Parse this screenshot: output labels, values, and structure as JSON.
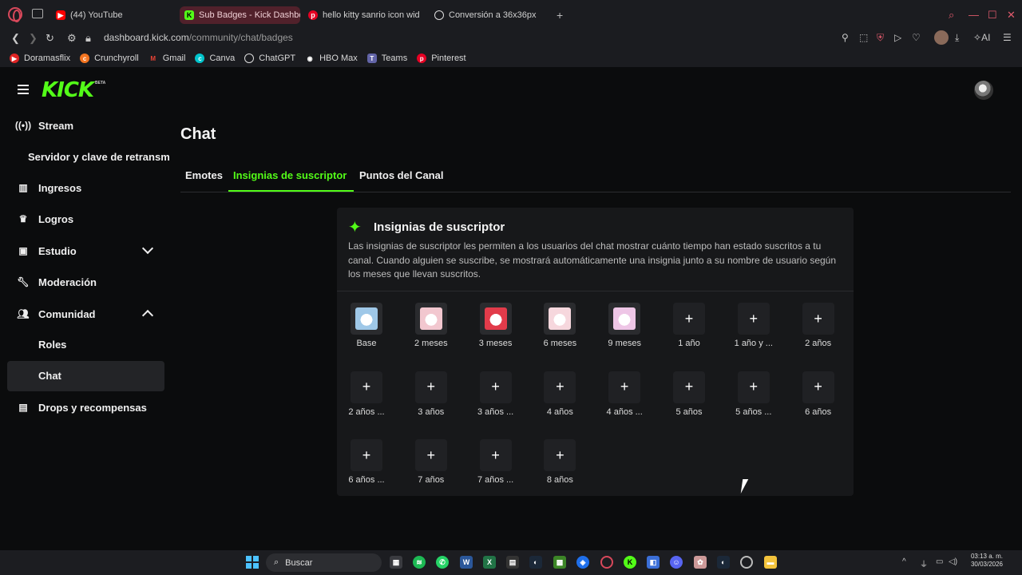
{
  "browser": {
    "tabs": [
      {
        "title": "(44) YouTube",
        "active": false,
        "icon": "youtube-icon",
        "color": "#ff0000"
      },
      {
        "title": "Sub Badges - Kick Dashbo",
        "active": true,
        "icon": "kick-icon",
        "color": "#53fc18"
      },
      {
        "title": "hello kitty sanrio icon wid",
        "active": false,
        "icon": "pinterest-icon",
        "color": "#e60023"
      },
      {
        "title": "Conversión a 36x36px",
        "active": false,
        "icon": "chatgpt-icon",
        "color": "#ffffff"
      }
    ],
    "url_host": "dashboard.kick.com",
    "url_path": "/community/chat/badges",
    "ai_label": "AI",
    "bookmarks": [
      {
        "label": "Doramasflix",
        "color": "#e02424"
      },
      {
        "label": "Crunchyroll",
        "color": "#f47521"
      },
      {
        "label": "Gmail",
        "color": "#ea4335"
      },
      {
        "label": "Canva",
        "color": "#00c4cc"
      },
      {
        "label": "ChatGPT",
        "color": "#ffffff"
      },
      {
        "label": "HBO Max",
        "color": "#ffffff"
      },
      {
        "label": "Teams",
        "color": "#6264a7"
      },
      {
        "label": "Pinterest",
        "color": "#e60023"
      }
    ]
  },
  "kick": {
    "logo": "KICK",
    "beta": "BETA",
    "accent": "#53fc18"
  },
  "sidebar": {
    "stream": "Stream",
    "stream_key": "Servidor y clave de retransm",
    "ingresos": "Ingresos",
    "logros": "Logros",
    "estudio": "Estudio",
    "moderacion": "Moderación",
    "comunidad": "Comunidad",
    "roles": "Roles",
    "chat": "Chat",
    "drops": "Drops y recompensas"
  },
  "main": {
    "title": "Chat",
    "tabs": [
      "Emotes",
      "Insignias de suscriptor",
      "Puntos del Canal"
    ],
    "card": {
      "title": "Insignias de suscriptor",
      "description": "Las insignias de suscriptor les permiten a los usuarios del chat mostrar cuánto tiempo han estado suscritos a tu canal. Cuando alguien se suscribe, se mostrará automáticamente una insignia junto a su nombre de usuario según los meses que llevan suscritos."
    },
    "badges": [
      {
        "label": "Base",
        "uploaded": true,
        "color": "#9fc8e8"
      },
      {
        "label": "2 meses",
        "uploaded": true,
        "color": "#f2c7cf"
      },
      {
        "label": "3 meses",
        "uploaded": true,
        "color": "#e23b4a"
      },
      {
        "label": "6 meses",
        "uploaded": true,
        "color": "#f6d7dd"
      },
      {
        "label": "9 meses",
        "uploaded": true,
        "color": "#eec6e6"
      },
      {
        "label": "1 año",
        "uploaded": false
      },
      {
        "label": "1 año y ...",
        "uploaded": false
      },
      {
        "label": "2 años",
        "uploaded": false
      },
      {
        "label": "2 años ...",
        "uploaded": false
      },
      {
        "label": "3 años",
        "uploaded": false
      },
      {
        "label": "3 años ...",
        "uploaded": false
      },
      {
        "label": "4 años",
        "uploaded": false
      },
      {
        "label": "4 años ...",
        "uploaded": false
      },
      {
        "label": "5 años",
        "uploaded": false
      },
      {
        "label": "5 años ...",
        "uploaded": false
      },
      {
        "label": "6 años",
        "uploaded": false
      },
      {
        "label": "6 años ...",
        "uploaded": false
      },
      {
        "label": "7 años",
        "uploaded": false
      },
      {
        "label": "7 años ...",
        "uploaded": false
      },
      {
        "label": "8 años",
        "uploaded": false
      }
    ],
    "add_symbol": "+"
  },
  "taskbar": {
    "search": "Buscar",
    "time": "03:13 a. m.",
    "date": "30/03/2026"
  }
}
